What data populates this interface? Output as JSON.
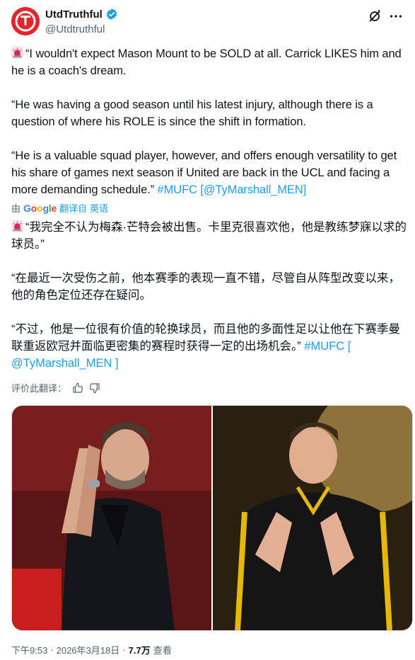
{
  "author": {
    "display_name": "UtdTruthful",
    "handle": "@Utdtruthful",
    "verified": true,
    "avatar_color": "#e8232a"
  },
  "tweet": {
    "para1": "“I wouldn't expect Mason Mount to be SOLD at all. Carrick LIKES him and he is a coach's dream.",
    "para2": "“He was having a good season until his latest injury, although there is a question of where his ROLE is since the shift in formation.",
    "para3": "“He is a valuable squad player, however, and offers enough versatility to get his share of games next season if United are back in the UCL and facing a more demanding schedule.”",
    "hashtag": "#MUFC",
    "mention_open": "[",
    "mention": "@TyMarshall_MEN",
    "mention_close": "]"
  },
  "translation": {
    "by_prefix": "由",
    "provider": "Google",
    "suffix": "翻译自",
    "language": "英语",
    "para1": "“我完全不认为梅森·芒特会被出售。卡里克很喜欢他，他是教练梦寐以求的球员。”",
    "para2": "“在最近一次受伤之前，他本赛季的表现一直不错，尽管自从阵型改变以来，他的角色定位还存在疑问。",
    "para3": "“不过，他是一位很有价值的轮换球员，而且他的多面性足以让他在下赛季曼联重返欧冠并面临更密集的赛程时获得一定的出场机会。”",
    "hashtag": "#MUFC",
    "mention_open": "[",
    "mention": "@TyMarshall_MEN",
    "mention_close": "]"
  },
  "rate_translation": {
    "label": "评价此翻译："
  },
  "footer": {
    "time": "下午9:53",
    "separator": "·",
    "date": "2026年3月18日",
    "views_count": "7.7万",
    "views_label": "查看"
  },
  "icons": {
    "verified": "verified-badge-icon",
    "grok": "grok-icon",
    "more": "more-icon",
    "siren": "siren-emoji-icon",
    "thumb_up": "thumb-up-icon",
    "thumb_down": "thumb-down-icon"
  },
  "colors": {
    "link": "#1d9bf0",
    "secondary_text": "#536471",
    "verified": "#1d9bf0",
    "siren": "#e0245e"
  }
}
